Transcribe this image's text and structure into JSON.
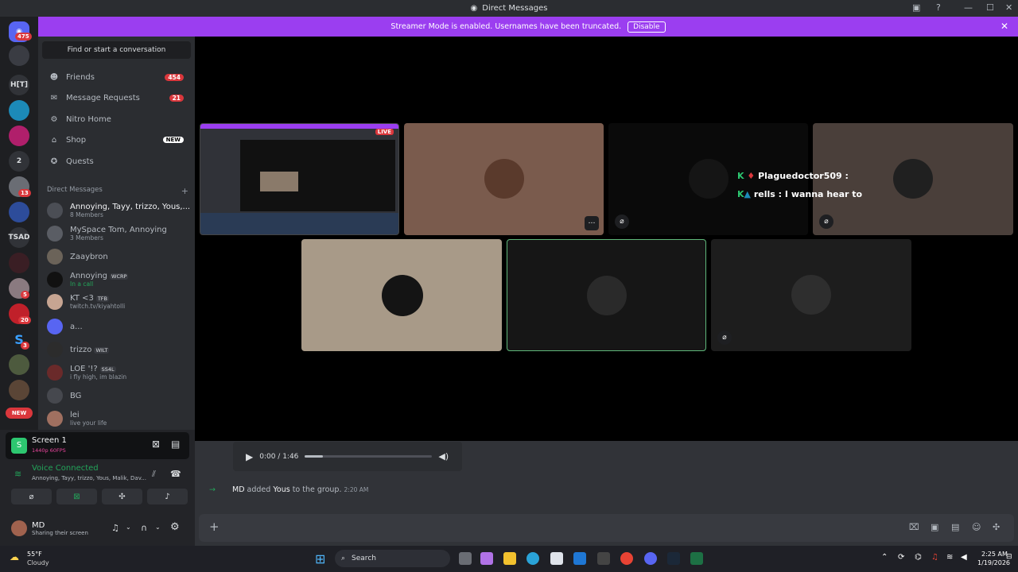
{
  "window": {
    "title": "Direct Messages"
  },
  "banner": {
    "text": "Streamer Mode is enabled. Usernames have been truncated.",
    "button": "Disable"
  },
  "guilds": {
    "home_badge": "475",
    "items": [
      "H[T]",
      "2",
      "TSAD",
      "NEW"
    ],
    "badges": [
      "13",
      "5",
      "20",
      "3"
    ]
  },
  "sidebar": {
    "find": "Find or start a conversation",
    "nav": [
      {
        "label": "Friends",
        "count": "454"
      },
      {
        "label": "Message Requests",
        "count": "21"
      },
      {
        "label": "Nitro Home"
      },
      {
        "label": "Shop",
        "badge": "NEW"
      },
      {
        "label": "Quests"
      }
    ],
    "dm_header": "Direct Messages",
    "dms": [
      {
        "name": "Annoying, Tayy, trizzo, Yous,...",
        "sub": "8 Members"
      },
      {
        "name": "MySpace Tom, Annoying",
        "sub": "3 Members"
      },
      {
        "name": "Zaaybron",
        "sub": ""
      },
      {
        "name": "Annoying",
        "tag": "WCRP",
        "sub": "In a call"
      },
      {
        "name": "KT <3",
        "tag": "TFB",
        "sub": "twitch.tv/kiyahtolli"
      },
      {
        "name": "a...",
        "sub": ""
      },
      {
        "name": "trizzo",
        "tag": "WILT",
        "sub": ""
      },
      {
        "name": "LOE '!?",
        "tag": "SS4L",
        "sub": "i fly high, im blazin"
      },
      {
        "name": "BG",
        "sub": ""
      },
      {
        "name": "lei",
        "sub": "live your life"
      }
    ]
  },
  "panel": {
    "screen_title": "Screen 1",
    "screen_sub": "1440p 60FPS",
    "voice_title": "Voice Connected",
    "voice_sub": "Annoying, Tayy, trizzo, Yous, Malik, Dav...",
    "user_name": "MD",
    "user_status": "Sharing their screen"
  },
  "stage": {
    "live_label": "LIVE",
    "overlay": [
      {
        "user": "Plaguedoctor509 :",
        "text": ""
      },
      {
        "user": "rells :",
        "text": "I wanna hear to"
      }
    ]
  },
  "chat": {
    "player_time": "0:00 / 1:46",
    "system": {
      "actor": "MD",
      "verb": "added",
      "target": "Yous",
      "rest": "to the group.",
      "time": "2:20 AM"
    }
  },
  "taskbar": {
    "weather_temp": "55°F",
    "weather_desc": "Cloudy",
    "search": "Search",
    "time": "2:25 AM",
    "date": "1/19/2026"
  },
  "colors": {
    "accent": "#9b3ef0",
    "green": "#23a55a",
    "red": "#da373c"
  }
}
